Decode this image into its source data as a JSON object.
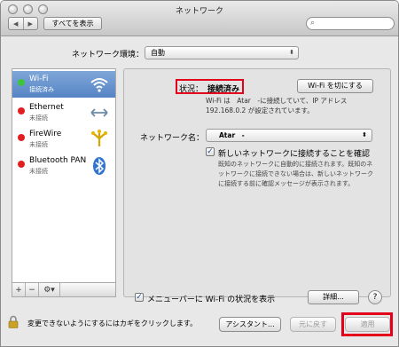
{
  "window": {
    "title": "ネットワーク"
  },
  "toolbar": {
    "back": "◀",
    "forward": "▶",
    "show_all": "すべてを表示",
    "search_placeholder": ""
  },
  "location": {
    "label": "ネットワーク環境：",
    "value": "自動"
  },
  "services": [
    {
      "name": "Wi-Fi",
      "status": "接続済み",
      "dot_color": "#3ec43e",
      "icon": "wifi-icon",
      "selected": true
    },
    {
      "name": "Ethernet",
      "status": "未接続",
      "dot_color": "#e02020",
      "icon": "ethernet-icon",
      "selected": false
    },
    {
      "name": "FireWire",
      "status": "未接続",
      "dot_color": "#e02020",
      "icon": "firewire-icon",
      "selected": false
    },
    {
      "name": "Bluetooth PAN",
      "status": "未接続",
      "dot_color": "#e02020",
      "icon": "bluetooth-icon",
      "selected": false
    }
  ],
  "sidebar_tools": {
    "add": "+",
    "remove": "−",
    "gear": "⚙▾"
  },
  "detail": {
    "status_label": "状況：",
    "status_value": "接続済み",
    "turn_off_label": "Wi-Fi を切にする",
    "status_desc_1": "Wi-Fi は　Atar　-",
    "status_desc_2": "に接続していて、IP アドレス 192.168.0.2 が設定されています。",
    "network_name_label": "ネットワーク名：",
    "network_name_value": "Atar　-",
    "ask_join_label": "新しいネットワークに接続することを確認",
    "ask_join_desc": "既知のネットワークに自動的に接続されます。既知のネットワークに接続できない場合は、新しいネットワークに接続する前に確認メッセージが表示されます。",
    "menubar_label": "メニューバーに Wi-Fi の状況を表示",
    "advanced_label": "詳細...",
    "help_label": "?"
  },
  "bottom": {
    "lock_text": "変更できないようにするにはカギをクリックします。",
    "assistant_label": "アシスタント...",
    "revert_label": "元に戻す",
    "apply_label": "適用"
  },
  "colors": {
    "highlight": "#e3001b",
    "selection": "#5684c4"
  }
}
